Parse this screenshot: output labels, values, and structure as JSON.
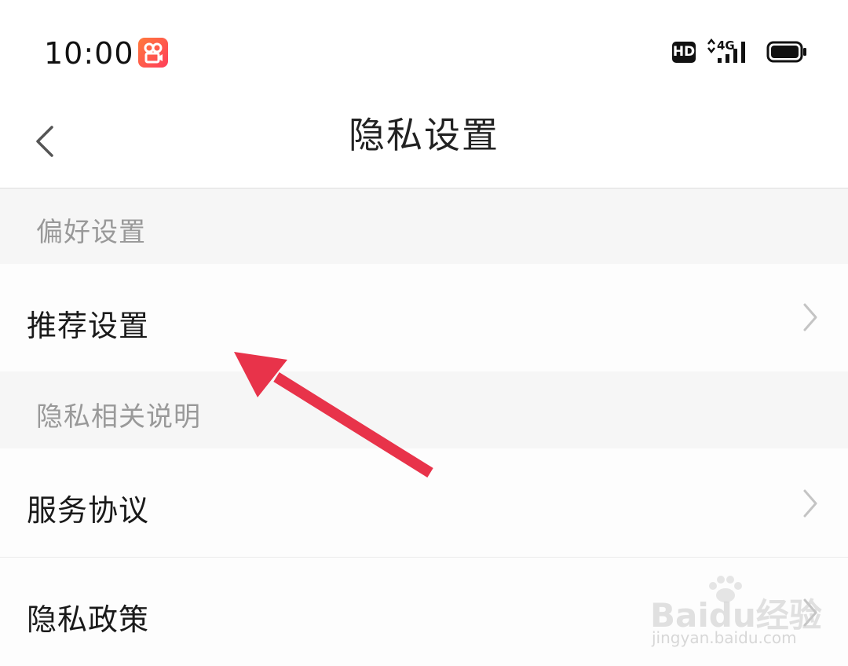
{
  "status_bar": {
    "time": "10:00",
    "hd_badge": "HD",
    "network": "4G"
  },
  "nav": {
    "title": "隐私设置"
  },
  "sections": [
    {
      "header": "偏好设置",
      "items": [
        {
          "label": "推荐设置"
        }
      ]
    },
    {
      "header": "隐私相关说明",
      "items": [
        {
          "label": "服务协议"
        },
        {
          "label": "隐私政策"
        }
      ]
    }
  ],
  "icons": {
    "back": "chevron-left-icon",
    "row_arrow": "chevron-right-icon",
    "annotation": "red-arrow-annotation"
  },
  "colors": {
    "annotation_arrow": "#e8334a",
    "section_bg": "#f6f6f6",
    "header_text": "#999999"
  },
  "watermark": {
    "logo": "Baidu经验",
    "url": "jingyan.baidu.com"
  }
}
